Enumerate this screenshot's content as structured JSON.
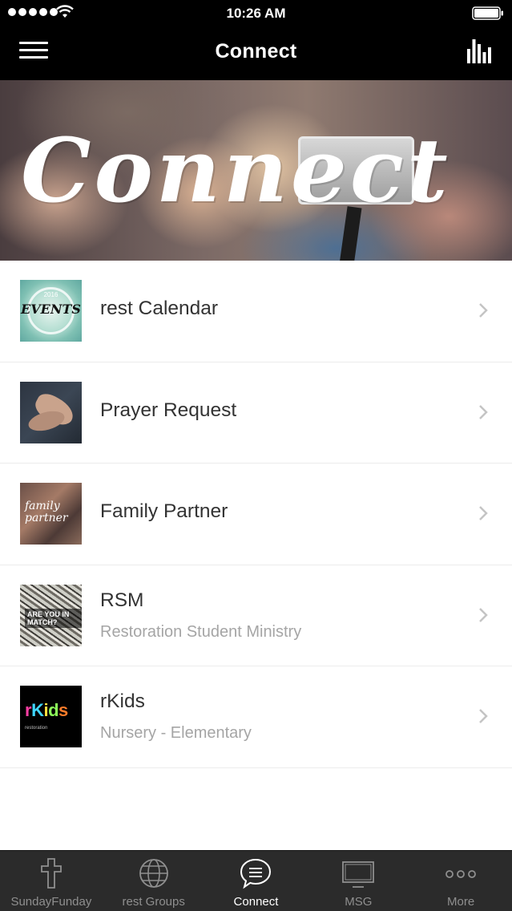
{
  "status_bar": {
    "time": "10:26 AM"
  },
  "nav": {
    "title": "Connect"
  },
  "hero": {
    "text": "Connect"
  },
  "list": [
    {
      "title": "rest Calendar",
      "subtitle": "",
      "thumb_text": "EVENTS",
      "thumb_year": "2016"
    },
    {
      "title": "Prayer Request",
      "subtitle": ""
    },
    {
      "title": "Family Partner",
      "subtitle": "",
      "thumb_text": "family partner"
    },
    {
      "title": "RSM",
      "subtitle": "Restoration Student Ministry",
      "thumb_text": "ARE YOU IN MATCH?"
    },
    {
      "title": "rKids",
      "subtitle": "Nursery - Elementary",
      "thumb_sub": "restoration"
    }
  ],
  "tabs": [
    {
      "label": "SundayFunday",
      "icon": "cross-icon"
    },
    {
      "label": "rest Groups",
      "icon": "globe-icon"
    },
    {
      "label": "Connect",
      "icon": "chat-bubble-icon",
      "active": true
    },
    {
      "label": "MSG",
      "icon": "monitor-icon"
    },
    {
      "label": "More",
      "icon": "more-dots-icon"
    }
  ],
  "colors": {
    "bar_background": "#000000",
    "tab_background": "#2b2b2b",
    "tab_active": "#ffffff",
    "tab_inactive": "#8f8f8f"
  }
}
